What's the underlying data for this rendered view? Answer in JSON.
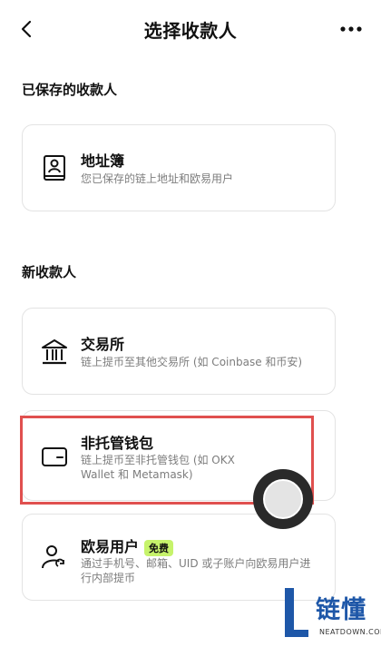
{
  "header": {
    "title": "选择收款人"
  },
  "saved": {
    "section_label": "已保存的收款人",
    "address_book": {
      "title": "地址簿",
      "desc": "您已保存的链上地址和欧易用户"
    }
  },
  "new": {
    "section_label": "新收款人",
    "exchange": {
      "title": "交易所",
      "desc": "链上提币至其他交易所 (如 Coinbase 和币安)"
    },
    "wallet": {
      "title": "非托管钱包",
      "desc": "链上提币至非托管钱包 (如 OKX Wallet 和 Metamask)"
    },
    "okx_user": {
      "title": "欧易用户",
      "badge": "免费",
      "desc": "通过手机号、邮箱、UID 或子账户向欧易用户进行内部提币"
    }
  },
  "watermark": {
    "brand": "链懂",
    "site": "NEATDOWN.COM"
  }
}
